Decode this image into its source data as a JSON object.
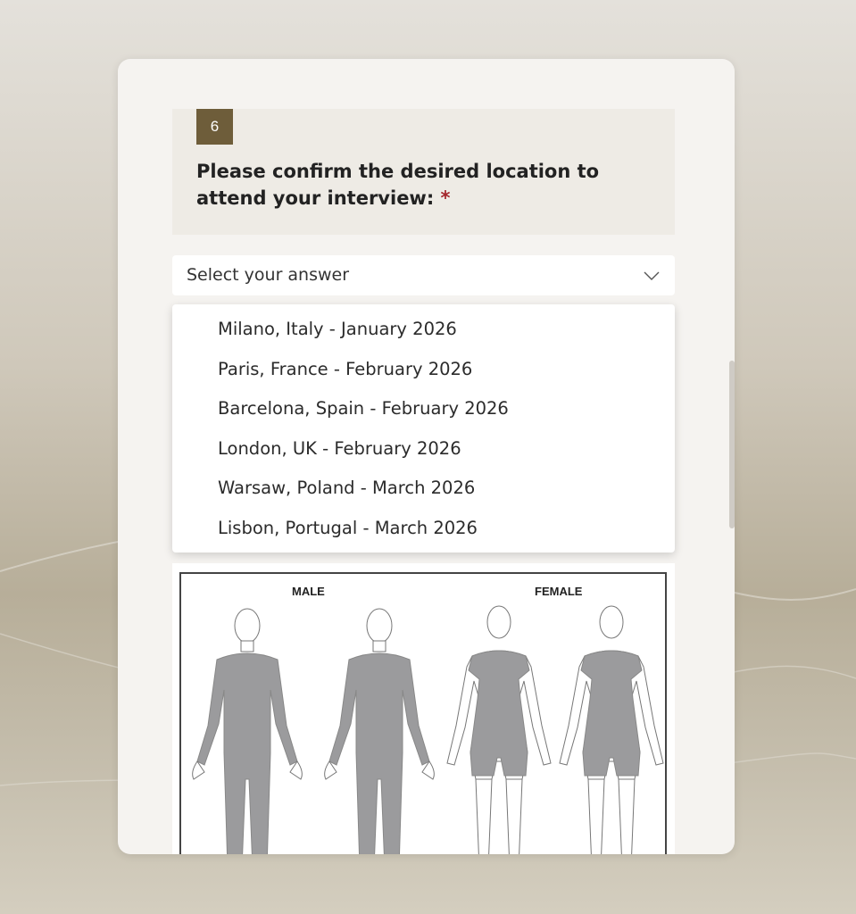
{
  "question": {
    "number": "6",
    "title": "Please confirm the desired location to attend your interview:",
    "required_mark": "*"
  },
  "select": {
    "placeholder": "Select your answer"
  },
  "options": [
    "Milano, Italy - January 2026",
    "Paris, France - February 2026",
    "Barcelona, Spain - February 2026",
    "London, UK - February 2026",
    "Warsaw, Poland - March 2026",
    "Lisbon, Portugal - March 2026"
  ],
  "body_chart": {
    "male_label": "MALE",
    "female_label": "FEMALE"
  },
  "colors": {
    "accent": "#6e5d3a",
    "required": "#a4262c",
    "figure_fill": "#9b9b9d"
  },
  "icons": {
    "dropdown": "chevron-down-icon"
  }
}
